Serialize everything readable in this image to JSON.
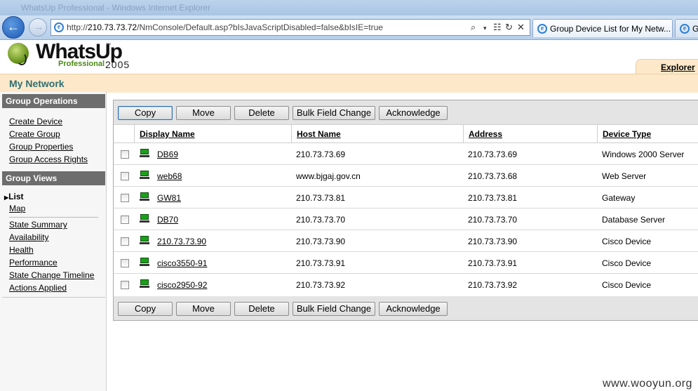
{
  "browser": {
    "window_title": "WhatsUp Professional - Windows Internet Explorer",
    "url_prefix": "http://",
    "url_host": "210.73.73.72",
    "url_path": "/NmConsole/Default.asp?bIsJavaScriptDisabled=false&bIsIE=true",
    "tabs": [
      {
        "label": "Group Device List for My Netw..."
      },
      {
        "label": "Gr"
      }
    ],
    "address_tools": [
      "search-icon",
      "dropdown-icon",
      "compat-icon",
      "refresh-icon",
      "stop-icon"
    ]
  },
  "app": {
    "logo_name": "WhatsUp",
    "logo_edition": "Professional",
    "logo_year": "2005",
    "logo_tm": "™",
    "explorer_tab": "Explorer",
    "section_title": "My Network"
  },
  "sidebar": {
    "group_operations": {
      "title": "Group Operations",
      "links": [
        "Create Device",
        "Create Group",
        "Group Properties",
        "Group Access Rights"
      ]
    },
    "group_views": {
      "title": "Group Views",
      "active": "List",
      "views": [
        "Map"
      ],
      "reports": [
        "State Summary",
        "Availability",
        "Health",
        "Performance",
        "State Change Timeline",
        "Actions Applied"
      ]
    }
  },
  "toolbar": {
    "copy": "Copy",
    "move": "Move",
    "delete": "Delete",
    "bulk_field_change": "Bulk Field Change",
    "acknowledge": "Acknowledge"
  },
  "table": {
    "columns": [
      "Display Name",
      "Host Name",
      "Address",
      "Device Type"
    ],
    "rows": [
      {
        "display_name": "DB69",
        "host_name": "210.73.73.69",
        "address": "210.73.73.69",
        "device_type": "Windows 2000 Server"
      },
      {
        "display_name": "web68",
        "host_name": "www.bjgaj.gov.cn",
        "address": "210.73.73.68",
        "device_type": "Web Server"
      },
      {
        "display_name": "GW81",
        "host_name": "210.73.73.81",
        "address": "210.73.73.81",
        "device_type": "Gateway"
      },
      {
        "display_name": "DB70",
        "host_name": "210.73.73.70",
        "address": "210.73.73.70",
        "device_type": "Database Server"
      },
      {
        "display_name": "210.73.73.90",
        "host_name": "210.73.73.90",
        "address": "210.73.73.90",
        "device_type": "Cisco Device"
      },
      {
        "display_name": "cisco3550-91",
        "host_name": "210.73.73.91",
        "address": "210.73.73.91",
        "device_type": "Cisco Device"
      },
      {
        "display_name": "cisco2950-92",
        "host_name": "210.73.73.92",
        "address": "210.73.73.92",
        "device_type": "Cisco Device"
      }
    ]
  },
  "watermark": "www.wooyun.org"
}
